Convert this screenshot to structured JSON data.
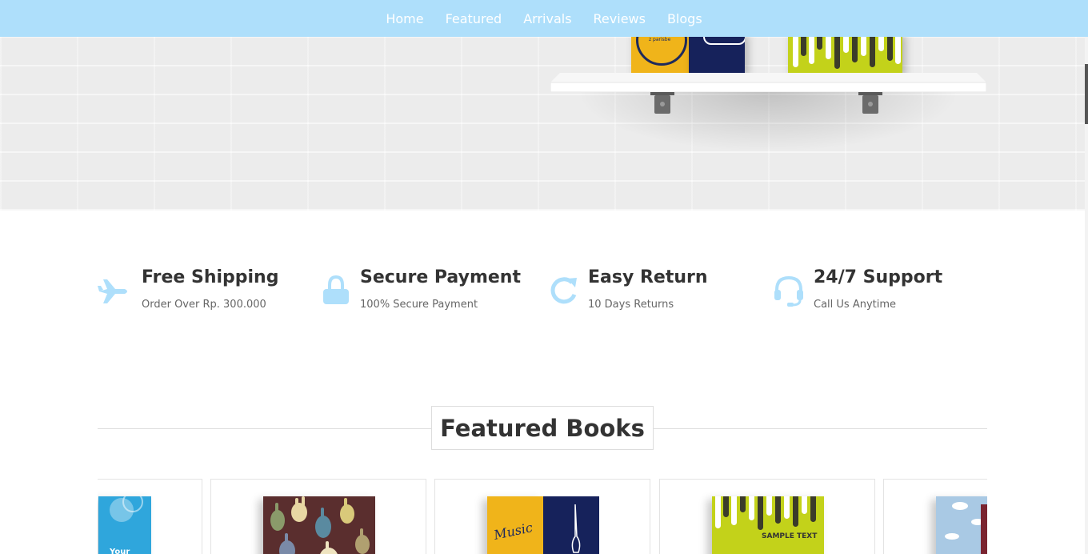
{
  "nav": {
    "items": [
      {
        "label": "Home"
      },
      {
        "label": "Featured"
      },
      {
        "label": "Arrivals"
      },
      {
        "label": "Reviews"
      },
      {
        "label": "Blogs"
      }
    ],
    "background": "#aedffb"
  },
  "hero": {
    "books": [
      {
        "cover_text": "z parisbe",
        "color": "#f0b41a"
      },
      {
        "cover_text": "",
        "color": "#16225b"
      },
      {
        "cover_text": "",
        "color": "#c3d21a"
      }
    ]
  },
  "features": [
    {
      "icon": "plane-icon",
      "title": "Free Shipping",
      "subtitle": "Order Over Rp. 300.000"
    },
    {
      "icon": "lock-icon",
      "title": "Secure Payment",
      "subtitle": "100% Secure Payment"
    },
    {
      "icon": "refresh-icon",
      "title": "Easy Return",
      "subtitle": "10 Days Returns"
    },
    {
      "icon": "headset-icon",
      "title": "24/7 Support",
      "subtitle": "Call Us Anytime"
    }
  ],
  "featured": {
    "heading": "Featured Books",
    "books": [
      {
        "cover_text": "Your",
        "color": "#2fa6dc"
      },
      {
        "cover_text": "",
        "color": "#5a2e2e"
      },
      {
        "cover_text": "Music",
        "color": "#f0b41a"
      },
      {
        "cover_text": "SAMPLE TEXT",
        "color": "#c3d21a"
      },
      {
        "cover_text": "",
        "color": "#a9c9e4"
      }
    ]
  },
  "accent_color": "#aedffb"
}
